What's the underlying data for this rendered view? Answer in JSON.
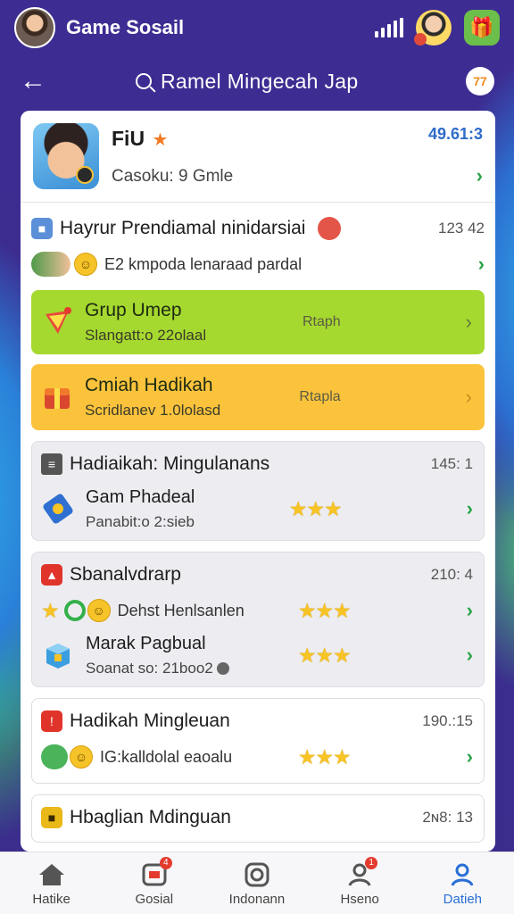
{
  "header": {
    "app_title": "Game Sosail"
  },
  "search": {
    "text": "Ramel Mingecah Jap",
    "badge": "77"
  },
  "profile": {
    "name": "FiU",
    "subtitle": "Casoku: 9 Gmle",
    "score": "49.61:3"
  },
  "section1": {
    "title": "Hayrur Prendiamal ninidarsiai",
    "time": "123 42",
    "row_text": "E2 kmpoda lenaraad pardal"
  },
  "card_green": {
    "title": "Grup Umep",
    "subtitle": "Slangatt:o 22olaal",
    "middle": "Rtaph"
  },
  "card_orange": {
    "title": "Cmiah Hadikah",
    "subtitle": "Scridlanev 1.0lolasd",
    "middle": "Rtapla"
  },
  "weekly": {
    "title": "Hadiaikah: Mingulanans",
    "time": "145: 1",
    "item_title": "Gam Phadeal",
    "item_sub": "Panabit:o 2:sieb"
  },
  "social": {
    "title": "Sbanalvdrarp",
    "time": "210: 4",
    "row_text": "Dehst Henlsanlen",
    "item_title": "Marak Pagbual",
    "item_sub": "Soanat so: 21boo2"
  },
  "weekly2": {
    "title": "Hadikah Mingleuan",
    "time": "190.:15",
    "row_text": "IG:kalldolal eaoalu"
  },
  "weekly3": {
    "title": "Hbaglian Mdinguan",
    "time": "2ɴ8: 13"
  },
  "tabs": [
    {
      "label": "Hatike",
      "icon": "home-icon"
    },
    {
      "label": "Gosial",
      "icon": "chat-icon",
      "badge": "4"
    },
    {
      "label": "Indonann",
      "icon": "camera-icon"
    },
    {
      "label": "Hseno",
      "icon": "friends-icon",
      "badge": "1"
    },
    {
      "label": "Datieh",
      "icon": "profile-icon"
    }
  ],
  "colors": {
    "background": "#3b2a8e",
    "accent_blue": "#2a6fd6",
    "green_card": "#a6d92f",
    "orange_card": "#fbc33c",
    "chevron_green": "#2aa347",
    "star_yellow": "#f7c325"
  }
}
